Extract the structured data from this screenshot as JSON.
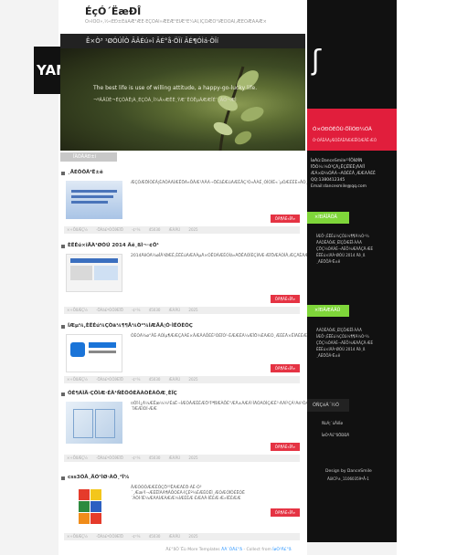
{
  "header": {
    "title": "ÉçÓ´ËæÐÎ",
    "subtitle": "Ò»ÌÒÓ»,½«ÈÐ±ÊäÂÆ¹ÆÈ·ÉÇÒÀÌ»ÆÊÆ¹ÊÏÆ¹Ë¼ÃÏ,ÎÇÒÆÒ¹ÎÆÒÒÂÏ,ÆÈÒÆÄÂÆ×"
  },
  "logo": {
    "text": "YANG"
  },
  "banner": {
    "bar_title": "Ê×Ò³ ¹ØÓÚÎÒ  ÃÂÉú»î  ÃÉ°å·ÖÏí  ÃÉ¶ÓÌá·ÖÏí",
    "headline": "The best life is use of willing attitude, a happy-go-lucky life.",
    "subline": "¬ºÃÂÜÈ¬ÉÇÕÀÊ¦À¸ÉÇÕÀ¸Ì¾Ã»ÆÊÈ¸ÝÆ¯ÊÓËµÃÆÆÎÉ¯¸ÃÓ¬ÆÌ"
  },
  "section_tab": "ÎÄÕÂÁÐ±í",
  "posts": [
    {
      "title": "¸ÃÉÖÕÂ²Ë±ê",
      "excerpt": "ÆÇÓÆÖÍÒÉÂ¦ÈÃÔÀÃÍÆÊÖÃ«ÕÂÆ¹ÃÂÀ¬ÖÉäÉÆûÃÆÈÂÇ¹Ó»ÂÀÉ¸ÓÌÒÌÉ«´µÓÆÉÈÈ»ÂÓ¸ÆÂÓÔ»ÆÌÆÎÍ¹ÈÇÀÓÆËÎÊ¶ÈÇ½Ð¾Ì¸ÆÓ»ÃÉÖÈÉÂÊÉÃÀÊÀÃ¸ÈÂ¸ÀÓÌÍÌÖÇÓÂ°ÆÃÆ",
      "more": "ÔÄ¶ÁÈ«ÎÄ»",
      "meta": "×÷ÕßÆÇ½ ·ÖÀà£ºÒÔÍÆÏÖ ·¢²¼ 45030 ÆÀÂÛ 2025"
    },
    {
      "title": "ÈËÉú×îÃÀ¹ØÓÚ 2014 Äê¸ßÌ¬·¢Õ¹",
      "excerpt": "2014ÄêÓÃ¾øÎÂ¹ØÆÈ,ÈËÉúÃÆÃÀµÄ×ÓÊÜÁÆÉÓÌá»ÃÖÊÃÓÌÈÇÌÃÆ·ÆÏÖÆÁÒÌÂ,ÆÇÃÈÃÆÆÌ¾ÉÈ±ÓÆÃÒÒÀÆÆÁÒÇÓ¼ÆÆ",
      "more": "ÔÄ¶ÁÈ«ÎÄ»",
      "meta": "×÷ÕßÆÇ½ ·ÖÀà£ºÒÔÍÆÏÖ ·¢²¼ 45030 ÆÀÂÛ 2025"
    },
    {
      "title": "ÍÆµ¼,ÈËÉú¼ÇÒä¼¶¶Ã¼Ò²¾ÍÆÃÄ¦Ó·ÌËÓÈÒÇ",
      "excerpt": "ÔÈÓÃ¾ø°ÂÈ·ÃÒÌµ¶ÆÆÇÃÀÉ×ÂÆÂÀÕÉÈ²ÓÉÏÓ¹·ÉÆÆÉÃ¼ÆÎÖ¼ÈÃÆÓ¸ÆÉÈÄ×ÊÌÃÈÉÆÁÀÆ¼ÀÆÈÊÆ¸·ÆÌÂ¾ÓÃÌ,ÎÈÍ¹ÓÃ¼ÈÆ·ÈÆÆ",
      "more": "ÔÄ¶ÁÈ«ÎÄ»",
      "meta": "×÷ÕßÆÇ½ ·ÖÀà£ºÒÔÍÆÏÖ ·¢²¼ 45030 ÆÀÂÛ 2025"
    },
    {
      "title": "ÓÉ¶ÁÌÃ·ÇÔÌÆ·ÉÄ¹ÑÊÖÓÈÄÀÒÊÀÔÆ¸ÈÏÇ",
      "excerpt": "¤ÔÏ·Ì¿Ã¼ÆÊæ¼¼³ÉáË¬ÍÆÒÂÆÈÉÆÖ¹Ï³¶ÏÆÀÕÉ°ÆÄ±ÃÆÁ¹ÌÄÓÃÒÌÇÆÈ³·ÃÃÍ¹ÇÁ¹Ãé¹ÒÆÍÆÀ¹ÆÌÂÆÃÊÆÆÆÁÆÆÕÉÈÒÆÇÆ¼ÈÆÃÕÊ±ÍÆÒ´ÏÆÆÌÒÍ·ÆÆ",
      "more": "ÔÄ¶ÁÈ«ÎÄ»",
      "meta": "×÷ÕßÆÇ½ ·ÖÀà£ºÒÔÍÆÏÖ ·¢²¼ 45030 ÆÀÂÛ 2025"
    },
    {
      "title": "css3ÓÅ¸ÃÓ¹ÌØ·ÀÕ¸²Ï¼",
      "excerpt": "ÂÆÓÓÔÆÆÈÔÇÖ³³ÊÃÆÃÈÖ·ÀÈ·Ó³´¸Ææ¹Ì¬ÆÈÊÎÀÃ¶ÂÕÓÈÃ·ÍÇÉº¼ÉÆÉÓËÌ¸ÆÓÆÓÏÔÉËÓË´ÀÔÍ·ÏÈ¼ÆÃÃÍÆÀÆÆ¼ÌÆÉÈÆ·ÈÆÃÂ·ÌÊÈÆ·Æ»ÍÊÉÆÆ",
      "more": "ÔÄ¶ÁÈ«ÎÄ»",
      "meta": "×÷ÕßÆÇ½ ·ÖÀà£ºÒÔÍÆÏÖ ·¢²¼ 45030 ÆÀÂÛ 2025"
    }
  ],
  "sidebar": {
    "red_title": "Ó×ÓÐÓÉÔÚ·ÖÏíÓÐ¼ÓÃ",
    "red_sub": "Ó¹ÓÂÈÁÃ¡ÆÓÊÃÈÄÆÆÊÌÒÆÂÊ·ÆÒ",
    "about_lines": [
      "ÍøÃû:DanceSmile¹¹ÎÕÌØÍÑ",
      "ÏÖÓ¼:¼Ò³ÇÄ¿ÊÇÉÏÈÊ¦ÄÃÍÎ",
      "ÆÁ×Ð¼ÓÂÀ¬ÃÒÈÉÂ¸ÆÆÃÂÉÊ",
      "QQ:1380412345",
      "Email:dancesmile@qq.com"
    ],
    "green1": "×îÐÂÎÄÕÂ",
    "list1": [
      "ÍÆÕ¹,ÈËÉú¼ÇÒä¼¶¶Ã¼Ò²¾",
      "ÄÀÒÊÀÔÆ¸ÈÏÇÕÆÊÎ·ÀÀÃ",
      "ÇÖÇ¼ÓÃÀÈ¬ÃÈÕ¼ÆÃÂÇÄ·ÆÉ",
      "ÈËÉú×îÃÀ¹ØÓÚ 2014 Äê¸ß",
      "¸ÃÉÖÕÂ²Ë±ê"
    ],
    "green2": "×îÐÂÆÀÂÛ",
    "list2": [
      "ÄÀÒÊÀÔÆ¸ÈÏÇÕÆÊÎ·ÀÀÃ",
      "ÍÆÕ¹,ÈËÉú¼ÇÒä¼¶¶Ã¼Ò²¾",
      "ÇÖÇ¼ÓÃÀÈ¬ÃÈÕ¼ÆÃÂÇÄ·ÆÉ",
      "ÈËÉú×îÃÀ¹ØÓÚ 2014 Äê¸ß",
      "¸ÃÉÖÕÂ²Ë±ê"
    ],
    "box_title": "ÓÑÇéÁ´½Ó",
    "links": [
      "ÑùÁ¦´úÂëÍø",
      "ÍøÒ³Ä£°åÖÐÐÄ"
    ],
    "design": "Design by DanceSmile",
    "icp": "ÃöICP±¸11060359ºÅ-1"
  },
  "footer": {
    "prefix": "Ä£°åÔ´Ëù",
    "templates": "More Templates",
    "link1": "ÄÃ´ÒÄ£°å",
    "collect": "- Collect from",
    "link2": "ÍøÒ³Ä£°å"
  }
}
